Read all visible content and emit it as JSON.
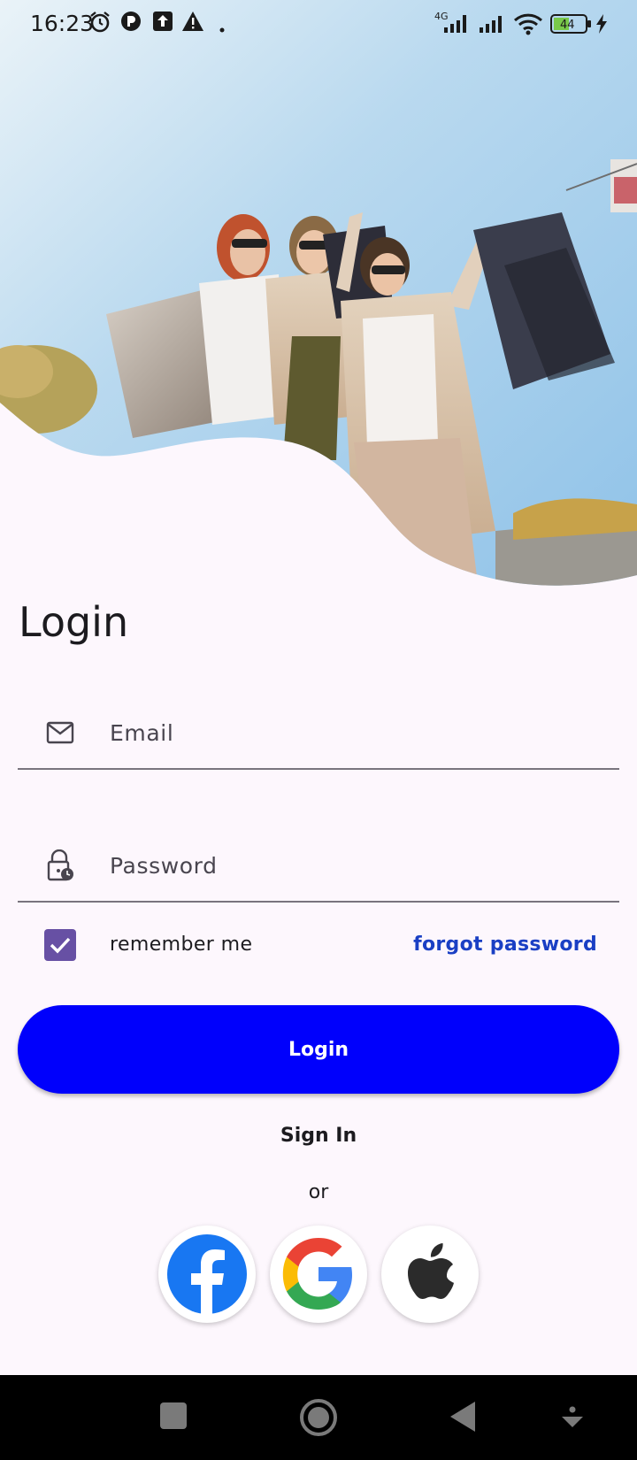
{
  "status_bar": {
    "time": "16:23",
    "network": "4G",
    "battery": "44",
    "icons": [
      "alarm-icon",
      "app-icon",
      "upload-icon",
      "warning-icon",
      "dot-icon",
      "signal-4g-icon",
      "signal-icon",
      "wifi-icon",
      "battery-icon",
      "charging-icon"
    ]
  },
  "hero": {
    "image": "women-shopping-bags-photo"
  },
  "page": {
    "title": "Login"
  },
  "form": {
    "email": {
      "label": "Email",
      "icon": "mail-icon"
    },
    "password": {
      "label": "Password",
      "icon": "lock-clock-icon"
    },
    "remember_me": {
      "label": "remember me",
      "checked": true
    },
    "forgot_password": "forgot password"
  },
  "actions": {
    "login_button": "Login",
    "sign_in": "Sign In",
    "or": "or"
  },
  "social": [
    "facebook-icon",
    "google-icon",
    "apple-icon"
  ],
  "colors": {
    "accent": "#0000fc",
    "checkbox": "#6750a4",
    "link": "#1a3fc4",
    "background": "#fdf7fd"
  },
  "nav_bar": [
    "recents-icon",
    "home-icon",
    "back-icon",
    "menu-down-icon"
  ]
}
